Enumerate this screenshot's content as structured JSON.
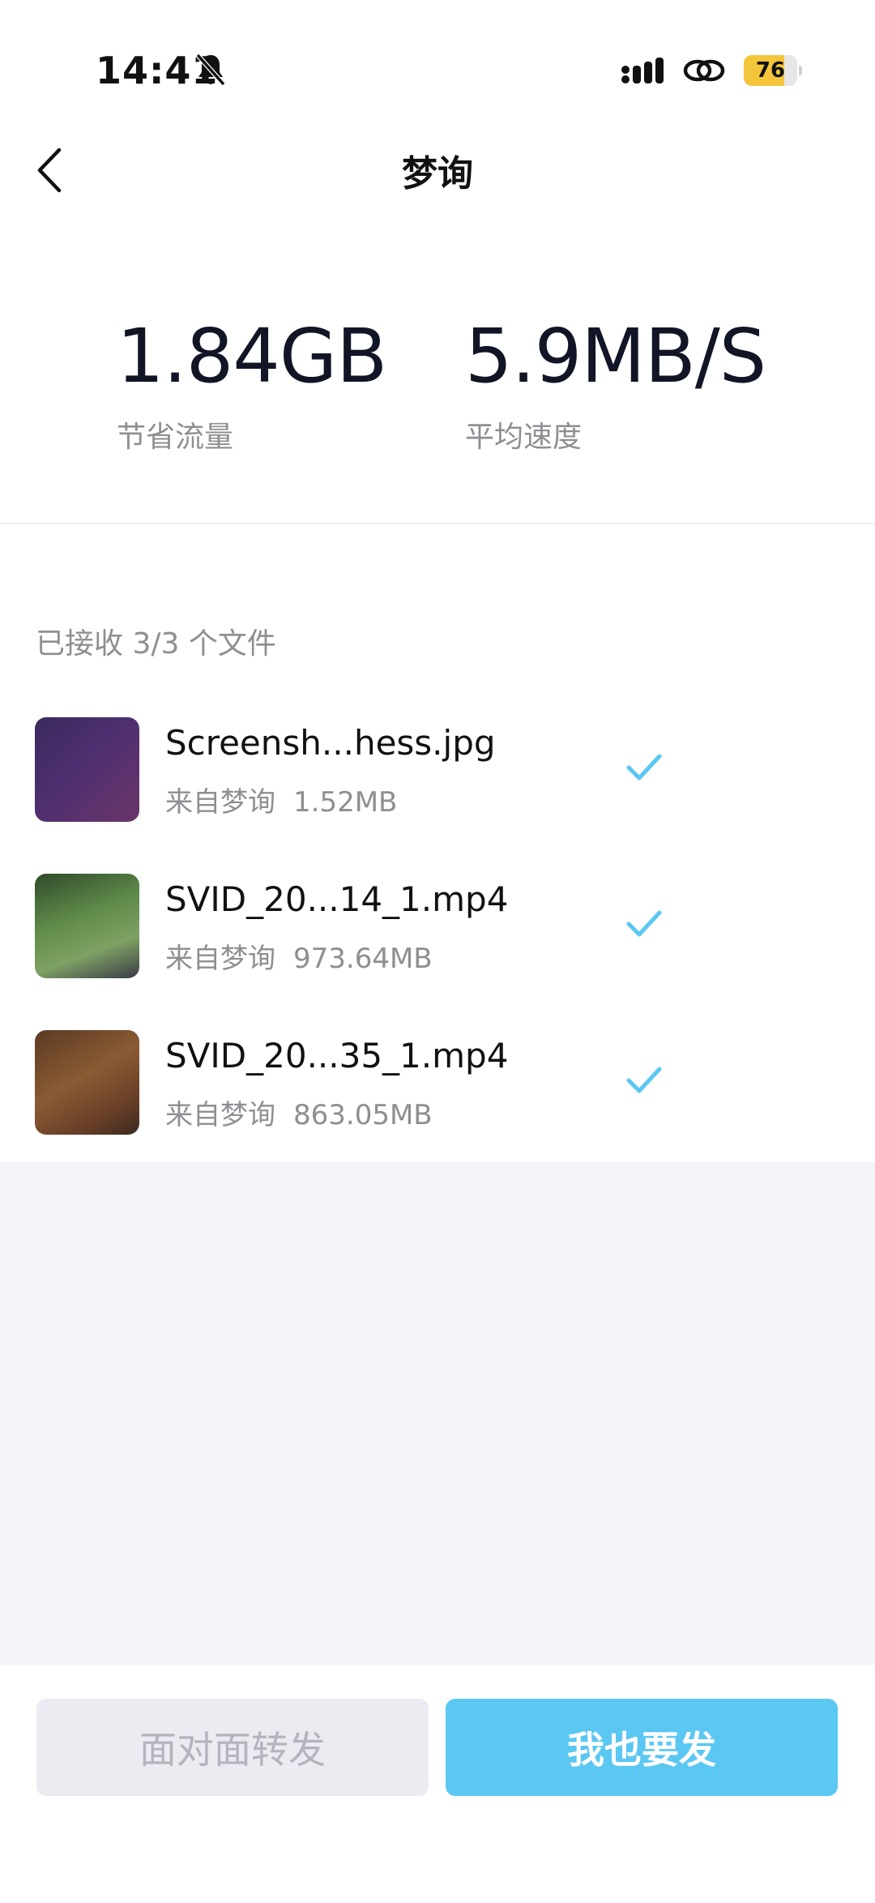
{
  "status_bar": {
    "time": "14:41",
    "battery_level": "76",
    "battery_fraction": 0.76,
    "icons": [
      "bell-muted-icon",
      "signal-icon",
      "link-icon",
      "battery-icon"
    ]
  },
  "nav": {
    "back_icon": "chevron-left-icon",
    "title": "梦询"
  },
  "stats": {
    "saved_value": "1.84GB",
    "saved_label": "节省流量",
    "speed_value": "5.9MB/S",
    "speed_label": "平均速度"
  },
  "files": {
    "header": "已接收 3/3 个文件",
    "items": [
      {
        "name": "Screensh...hess.jpg",
        "source": "来自梦询",
        "size": "1.52MB",
        "status_icon": "check-icon"
      },
      {
        "name": "SVID_20...14_1.mp4",
        "source": "来自梦询",
        "size": "973.64MB",
        "status_icon": "check-icon"
      },
      {
        "name": "SVID_20...35_1.mp4",
        "source": "来自梦询",
        "size": "863.05MB",
        "status_icon": "check-icon"
      }
    ]
  },
  "actions": {
    "forward_label": "面对面转发",
    "send_label": "我也要发"
  },
  "colors": {
    "accent": "#5bc7f3",
    "check": "#5bc7f3",
    "battery": "#f4c53b",
    "secondary_text": "#8e8e93",
    "disabled_bg": "#ebebf1",
    "gray_bg": "#f3f4f8"
  }
}
